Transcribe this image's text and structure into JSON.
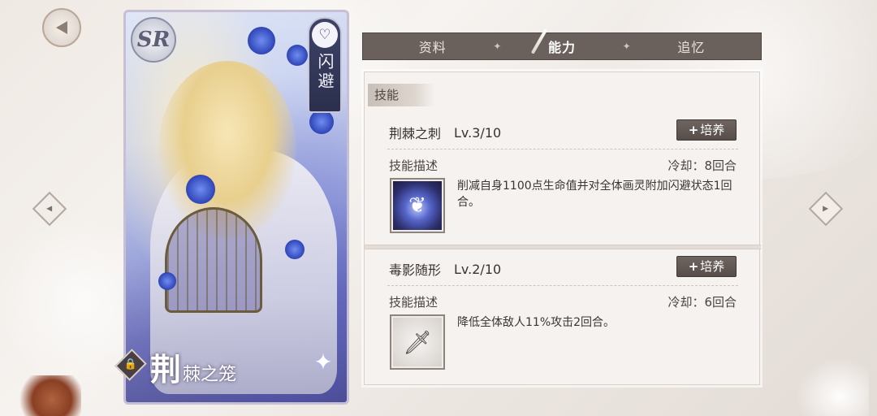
{
  "card": {
    "rarity": "SR",
    "role_tag": "闪避",
    "name_first": "荆",
    "name_rest": "棘之笼"
  },
  "tabs": [
    {
      "label": "资料",
      "active": false
    },
    {
      "label": "能力",
      "active": true
    },
    {
      "label": "追忆",
      "active": false
    }
  ],
  "panel": {
    "section_label": "技能"
  },
  "skills": [
    {
      "name": "荆棘之刺",
      "level": "Lv.3/10",
      "train_label": "培养",
      "desc_label": "技能描述",
      "cooldown": "冷却：8回合",
      "description": "削减自身1100点生命值并对全体画灵附加闪避状态1回合。",
      "icon": "thorn-skill-icon"
    },
    {
      "name": "毒影随形",
      "level": "Lv.2/10",
      "train_label": "培养",
      "desc_label": "技能描述",
      "cooldown": "冷却：6回合",
      "description": "降低全体敌人11%攻击2回合。",
      "icon": "poison-sword-skill-icon"
    }
  ],
  "colors": {
    "tab_bar": "#6b615c",
    "panel_bg": "#f5f2ef",
    "button_bg": "#574e4a",
    "card_accent": "#2f44b8"
  }
}
